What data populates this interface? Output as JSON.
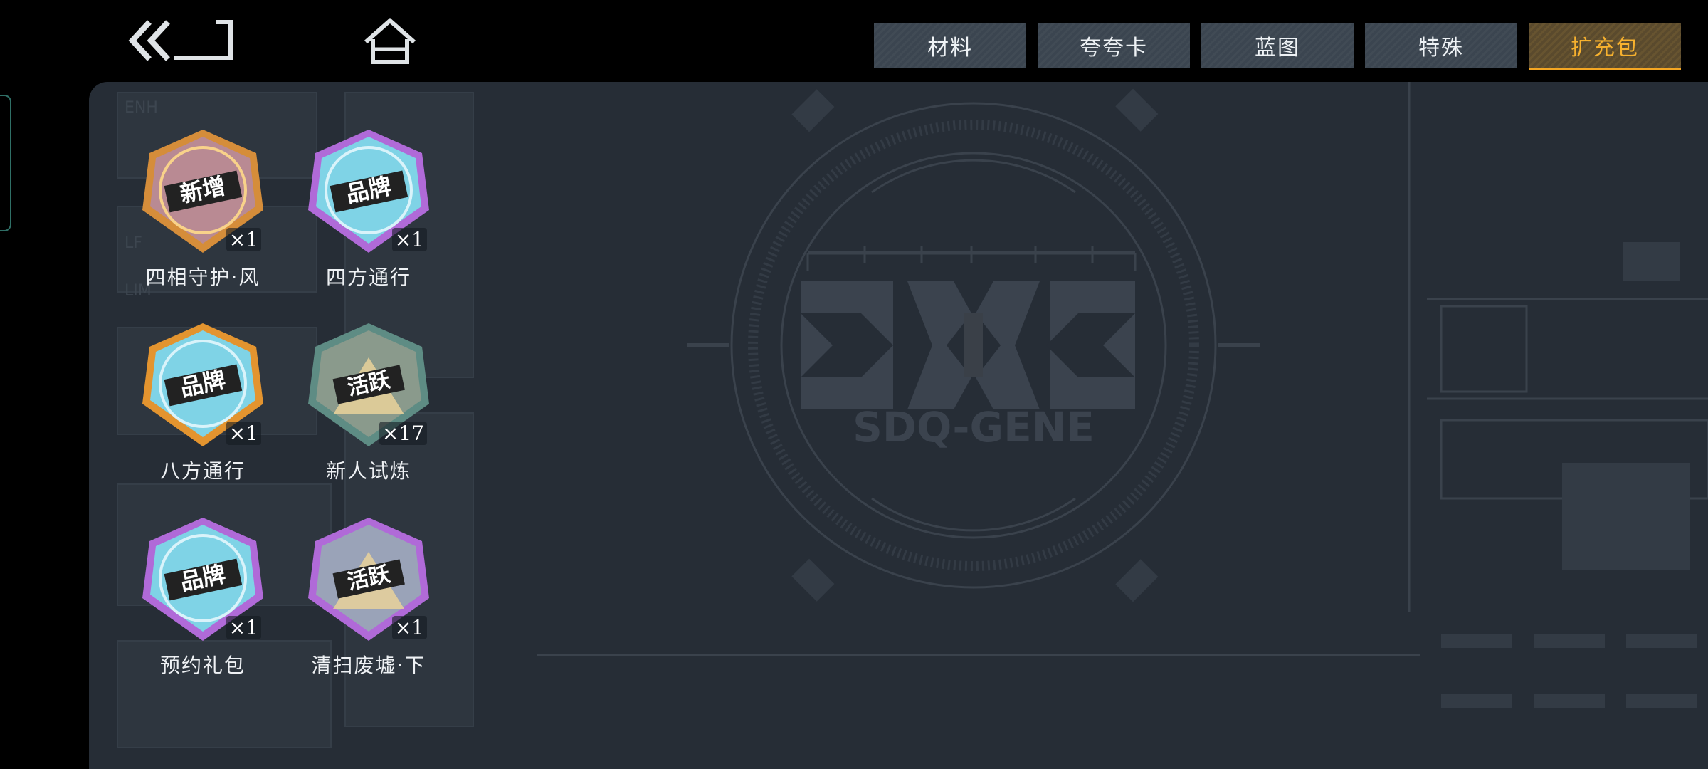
{
  "nav": {
    "back_icon": "double-chevron-back-icon",
    "home_icon": "home-icon"
  },
  "tabs": [
    {
      "label": "材料",
      "active": false
    },
    {
      "label": "夸夸卡",
      "active": false
    },
    {
      "label": "蓝图",
      "active": false
    },
    {
      "label": "特殊",
      "active": false
    },
    {
      "label": "扩充包",
      "active": true
    }
  ],
  "items": [
    {
      "name": "四相守护·风",
      "count": "×1",
      "badge": "新增",
      "rim": "#f2a53a",
      "fill": "#b98a93"
    },
    {
      "name": "四方通行",
      "count": "×1",
      "badge": "品牌",
      "rim": "#c27be6",
      "fill": "#7fd3e6"
    },
    {
      "name": "八方通行",
      "count": "×1",
      "badge": "品牌",
      "rim": "#f2a53a",
      "fill": "#7fd3e6"
    },
    {
      "name": "新人试炼",
      "count": "×17",
      "badge": "活跃",
      "rim": "#6aa59a",
      "fill": "#8a9a8c"
    },
    {
      "name": "预约礼包",
      "count": "×1",
      "badge": "品牌",
      "rim": "#c27be6",
      "fill": "#7fd3e6"
    },
    {
      "name": "清扫废墟·下",
      "count": "×1",
      "badge": "活跃",
      "rim": "#c27be6",
      "fill": "#9aa3b8"
    }
  ],
  "background": {
    "logo_text": "SDQ-GENE",
    "tech_labels": [
      "ENH",
      "LF",
      "LIM"
    ]
  },
  "colors": {
    "accent": "#f4a623",
    "panel": "#262d36",
    "tab": "#3b4550"
  }
}
